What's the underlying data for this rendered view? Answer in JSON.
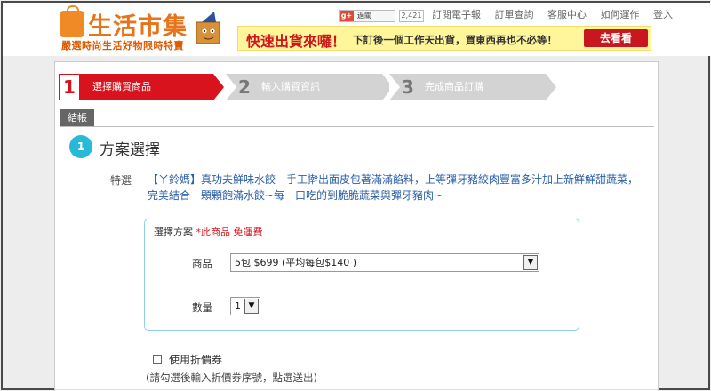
{
  "header": {
    "logo_title": "生活市集",
    "logo_tagline": "嚴選時尚生活好物限時特賣",
    "gplus_label": "g+",
    "gplus_action": "過關",
    "gplus_count": "2,421",
    "links": [
      "訂閱電子報",
      "訂單查詢",
      "客服中心",
      "如何運作",
      "登入"
    ],
    "banner_main": "快速出貨來囉！",
    "banner_sub": "下訂後一個工作天出貨，買東西再也不必等！",
    "banner_button": "去看看"
  },
  "steps": [
    {
      "num": "1",
      "label": "選擇購買商品"
    },
    {
      "num": "2",
      "label": "輸入購買資訊"
    },
    {
      "num": "3",
      "label": "完成商品訂購"
    }
  ],
  "tab": {
    "label": "結帳"
  },
  "section": {
    "num": "1",
    "title": "方案選擇"
  },
  "feature": {
    "label": "特選",
    "text": "【ㄚ鈴媽】真功夫鮮味水餃 - 手工擀出面皮包著滿滿餡料，上等彈牙豬絞肉豐富多汁加上新鮮鮮甜蔬菜，完美結合一顆顆飽滿水餃~每一口吃的到脆脆蔬菜與彈牙豬肉~"
  },
  "plan": {
    "label": "選擇方案",
    "free_note": "*此商品 免運費",
    "product_label": "商品",
    "product_value": "5包 $699 (平均每包$140 )",
    "qty_label": "數量",
    "qty_value": "1"
  },
  "coupon": {
    "label": "使用折價券",
    "hint": "(請勾選後輸入折價券序號，點選送出)"
  },
  "colors": {
    "accent_red": "#d9131d",
    "brand_orange": "#e8731a",
    "section_blue": "#29b9d8",
    "link_blue": "#2a5fa8"
  }
}
